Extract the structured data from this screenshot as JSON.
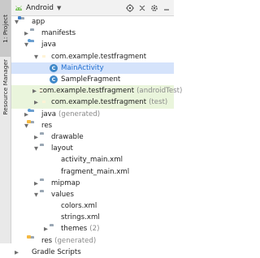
{
  "side_tabs": {
    "project": "1: Project",
    "resource_manager": "Resource Manager"
  },
  "toolbar": {
    "title": "Android",
    "icons": [
      "chevron-down-icon",
      "target-icon",
      "collapse-icon",
      "gear-icon",
      "minimize-icon"
    ]
  },
  "tree": [
    {
      "label": "app",
      "indent": 0,
      "arrow": "down",
      "icon": "folder-module"
    },
    {
      "label": "manifests",
      "indent": 1,
      "arrow": "right",
      "icon": "folder"
    },
    {
      "label": "java",
      "indent": 1,
      "arrow": "down",
      "icon": "folder-java"
    },
    {
      "label": "com.example.testfragment",
      "indent": 2,
      "arrow": "down",
      "icon": "package"
    },
    {
      "label": "MainActivity",
      "indent": 3,
      "arrow": "",
      "icon": "class",
      "selected": true
    },
    {
      "label": "SampleFragment",
      "indent": 3,
      "arrow": "",
      "icon": "class"
    },
    {
      "label": "com.example.testfragment",
      "suffix": "(androidTest)",
      "indent": 2,
      "arrow": "right",
      "icon": "package",
      "test": true
    },
    {
      "label": "com.example.testfragment",
      "suffix": "(test)",
      "indent": 2,
      "arrow": "right",
      "icon": "package",
      "test": true
    },
    {
      "label": "java",
      "suffix": "(generated)",
      "indent": 1,
      "arrow": "right",
      "icon": "folder-java"
    },
    {
      "label": "res",
      "indent": 1,
      "arrow": "down",
      "icon": "folder-res"
    },
    {
      "label": "drawable",
      "indent": 2,
      "arrow": "right",
      "icon": "folder"
    },
    {
      "label": "layout",
      "indent": 2,
      "arrow": "down",
      "icon": "folder"
    },
    {
      "label": "activity_main.xml",
      "indent": 3,
      "arrow": "",
      "icon": "xml"
    },
    {
      "label": "fragment_main.xml",
      "indent": 3,
      "arrow": "",
      "icon": "xml"
    },
    {
      "label": "mipmap",
      "indent": 2,
      "arrow": "right",
      "icon": "folder"
    },
    {
      "label": "values",
      "indent": 2,
      "arrow": "down",
      "icon": "folder"
    },
    {
      "label": "colors.xml",
      "indent": 3,
      "arrow": "",
      "icon": "xml"
    },
    {
      "label": "strings.xml",
      "indent": 3,
      "arrow": "",
      "icon": "xml"
    },
    {
      "label": "themes",
      "suffix": "(2)",
      "indent": 3,
      "arrow": "right",
      "icon": "folder"
    },
    {
      "label": "res",
      "suffix": "(generated)",
      "indent": 1,
      "arrow": "",
      "icon": "folder-res"
    },
    {
      "label": "Gradle Scripts",
      "indent": 0,
      "arrow": "right",
      "icon": "gradle"
    }
  ],
  "colors": {
    "selected_bg": "#d5e3fb",
    "selected_text": "#1f6fd1",
    "test_bg": "#eaf5dc"
  }
}
